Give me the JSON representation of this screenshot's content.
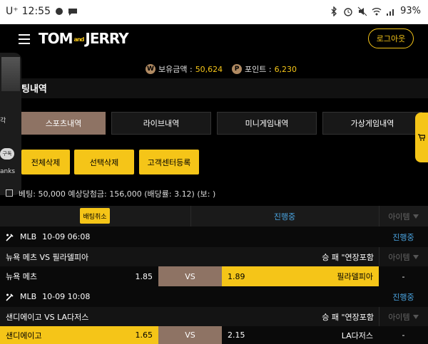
{
  "status_bar": {
    "carrier": "U⁺",
    "time": "12:55",
    "battery": "93%"
  },
  "header": {
    "logo_main": "TOM",
    "logo_and": "and",
    "logo_end": "JERRY",
    "logout_label": "로그아웃"
  },
  "balance": {
    "money_icon": "W",
    "money_label": "보유금액 : ",
    "money_value": "50,624",
    "point_icon": "P",
    "point_label": "포인트 : ",
    "point_value": "6,230"
  },
  "page": {
    "title": "팅내역"
  },
  "tabs": [
    {
      "label": "스포츠내역"
    },
    {
      "label": "라이브내역"
    },
    {
      "label": "미니게임내역"
    },
    {
      "label": "가상게임내역"
    }
  ],
  "actions": [
    {
      "label": "전체삭제"
    },
    {
      "label": "선택삭제"
    },
    {
      "label": "고객센터등록"
    }
  ],
  "overlay": {
    "text1": "각",
    "pill": "구독",
    "text2": "anks"
  },
  "bet_summary": "베팅: 50,000 예상당첨금: 156,000 (배당률: 3.12) (보: )",
  "table_head": {
    "cancel": "배팅취소",
    "status": "진행중",
    "item": "아이템"
  },
  "games": [
    {
      "league": "MLB",
      "datetime": "10-09 06:08",
      "status": "진행중",
      "match": "뉴욕 메츠 VS 필라델피아",
      "market": "승 패 \"연장포함",
      "item": "아이템",
      "home": "뉴욕 메츠",
      "home_odds": "1.85",
      "vs": "VS",
      "away_odds": "1.89",
      "away": "필라델피아",
      "result": "-"
    },
    {
      "league": "MLB",
      "datetime": "10-09 10:08",
      "status": "진행중",
      "match": "샌디에이고 VS LA다저스",
      "market": "승 패 \"연장포함",
      "item": "아이템",
      "home": "샌디에이고",
      "home_odds": "1.65",
      "vs": "VS",
      "away_odds": "2.15",
      "away": "LA다저스",
      "result": "-"
    }
  ],
  "colors": {
    "accent": "#f5c518",
    "active_tab": "#8e7364",
    "status_blue": "#4aa3df"
  }
}
